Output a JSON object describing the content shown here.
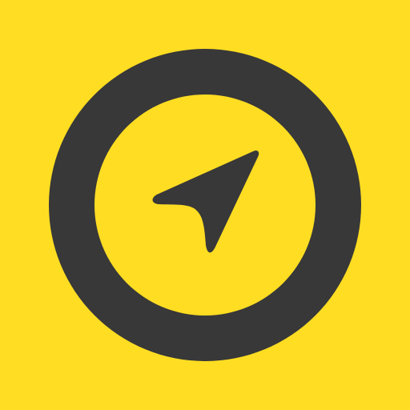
{
  "app_icon": {
    "icon_name": "navigation-arrow-icon",
    "colors": {
      "background": "#FFDD22",
      "ring": "#383838",
      "inner": "#FFDD22",
      "arrow": "#383838"
    }
  }
}
